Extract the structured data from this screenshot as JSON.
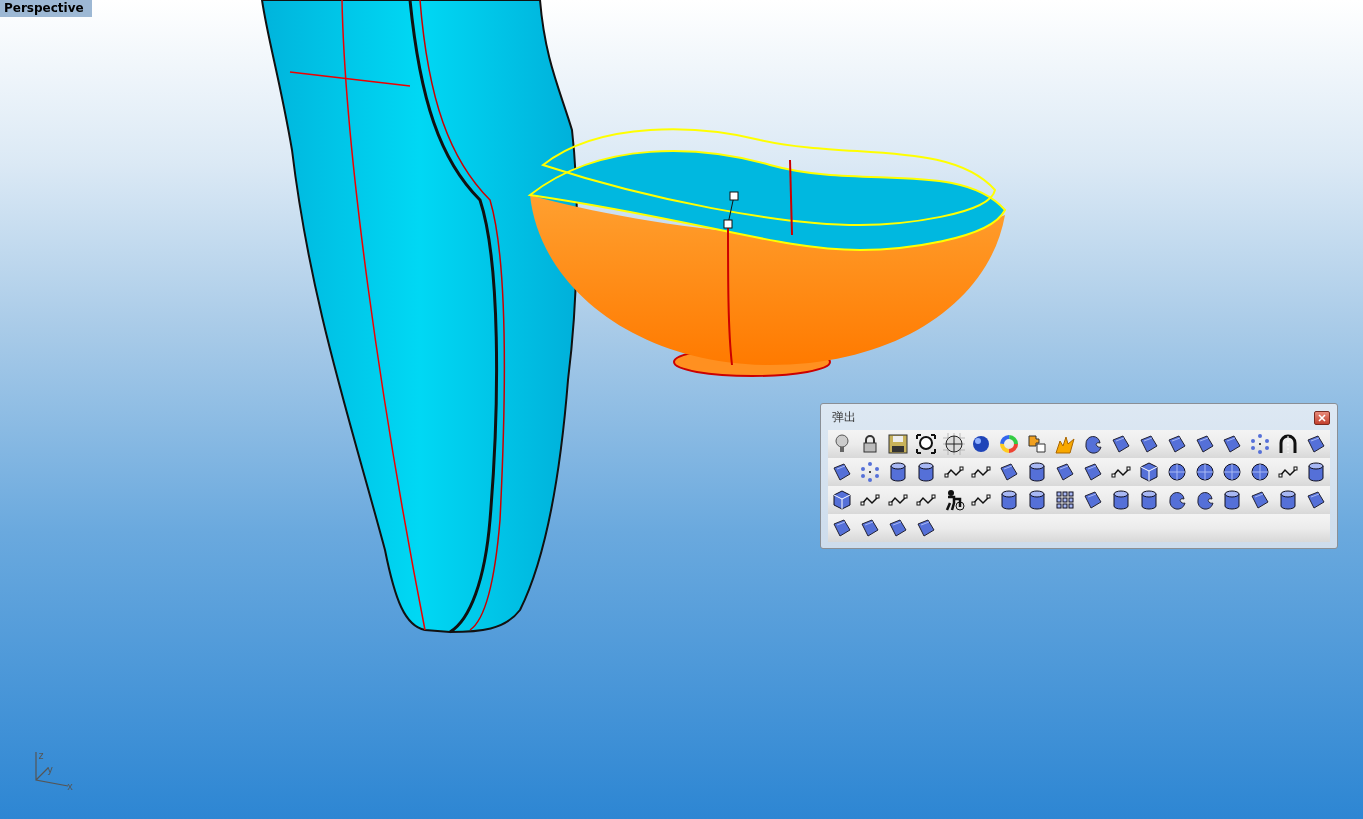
{
  "viewport": {
    "title": "Perspective"
  },
  "axis": {
    "labels": [
      "z",
      "y",
      "x"
    ]
  },
  "toolbar": {
    "title": "弹出"
  }
}
